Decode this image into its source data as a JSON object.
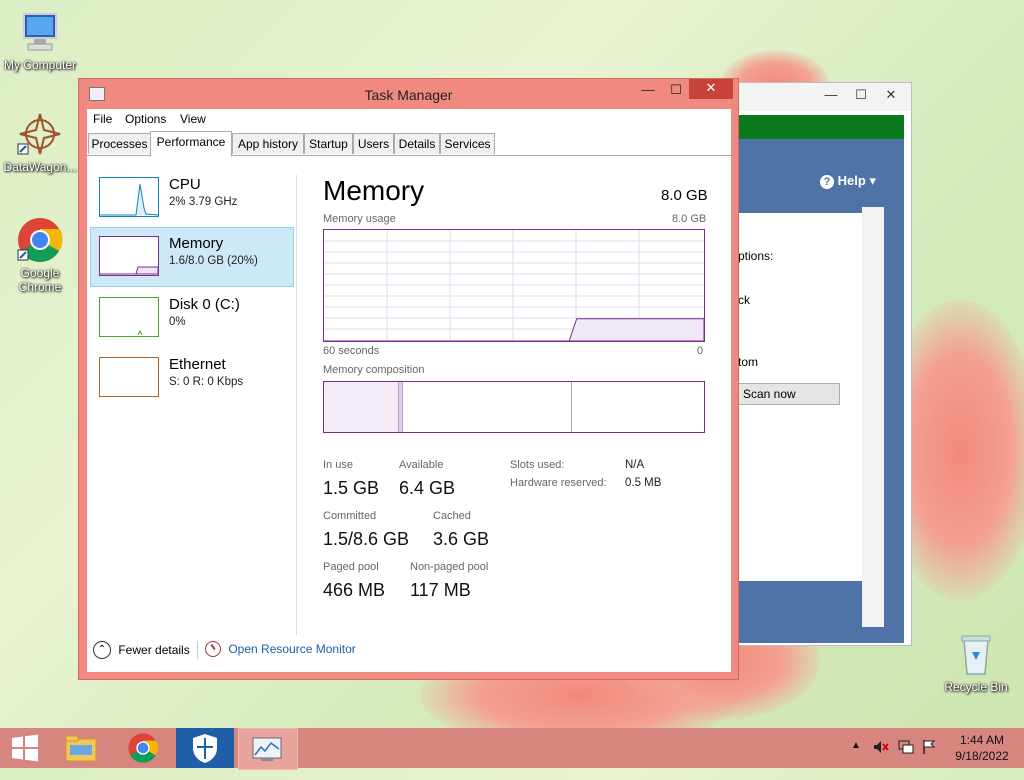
{
  "desktop": {
    "icons": [
      {
        "label": "My Computer"
      },
      {
        "label": "DataWagon..."
      },
      {
        "label": "Google Chrome"
      },
      {
        "label": "Recycle Bin"
      }
    ]
  },
  "back_window": {
    "help_label": "Help",
    "texts": [
      "ptions:",
      "ck",
      "tom"
    ],
    "scan_button": "Scan now",
    "minimize": "—",
    "maximize": "☐",
    "close": "✕"
  },
  "task_manager": {
    "title": "Task Manager",
    "minimize": "—",
    "maximize": "☐",
    "close": "✕",
    "menu": [
      "File",
      "Options",
      "View"
    ],
    "tabs": [
      "Processes",
      "Performance",
      "App history",
      "Startup",
      "Users",
      "Details",
      "Services"
    ],
    "active_tab": "Performance",
    "sidebar": [
      {
        "title": "CPU",
        "subtitle": "2% 3.79 GHz"
      },
      {
        "title": "Memory",
        "subtitle": "1.6/8.0 GB (20%)"
      },
      {
        "title": "Disk 0 (C:)",
        "subtitle": "0%"
      },
      {
        "title": "Ethernet",
        "subtitle": "S: 0 R: 0 Kbps"
      }
    ],
    "memory": {
      "heading": "Memory",
      "total": "8.0 GB",
      "usage_label": "Memory usage",
      "usage_max": "8.0 GB",
      "time_left": "60 seconds",
      "time_right": "0",
      "composition_label": "Memory composition",
      "usage_fraction": 0.2,
      "stats": {
        "in_use_label": "In use",
        "in_use": "1.5 GB",
        "available_label": "Available",
        "available": "6.4 GB",
        "committed_label": "Committed",
        "committed": "1.5/8.6 GB",
        "cached_label": "Cached",
        "cached": "3.6 GB",
        "paged_label": "Paged pool",
        "paged": "466 MB",
        "nonpaged_label": "Non-paged pool",
        "nonpaged": "117 MB",
        "slots_label": "Slots used:",
        "slots": "N/A",
        "hwres_label": "Hardware reserved:",
        "hwres": "0.5 MB"
      }
    },
    "footer": {
      "fewer_details": "Fewer details",
      "open_monitor": "Open Resource Monitor"
    }
  },
  "taskbar": {
    "time": "1:44 AM",
    "date": "9/18/2022",
    "colors": {
      "accent": "#7a2d90",
      "taskbar": "#d7857f"
    }
  }
}
